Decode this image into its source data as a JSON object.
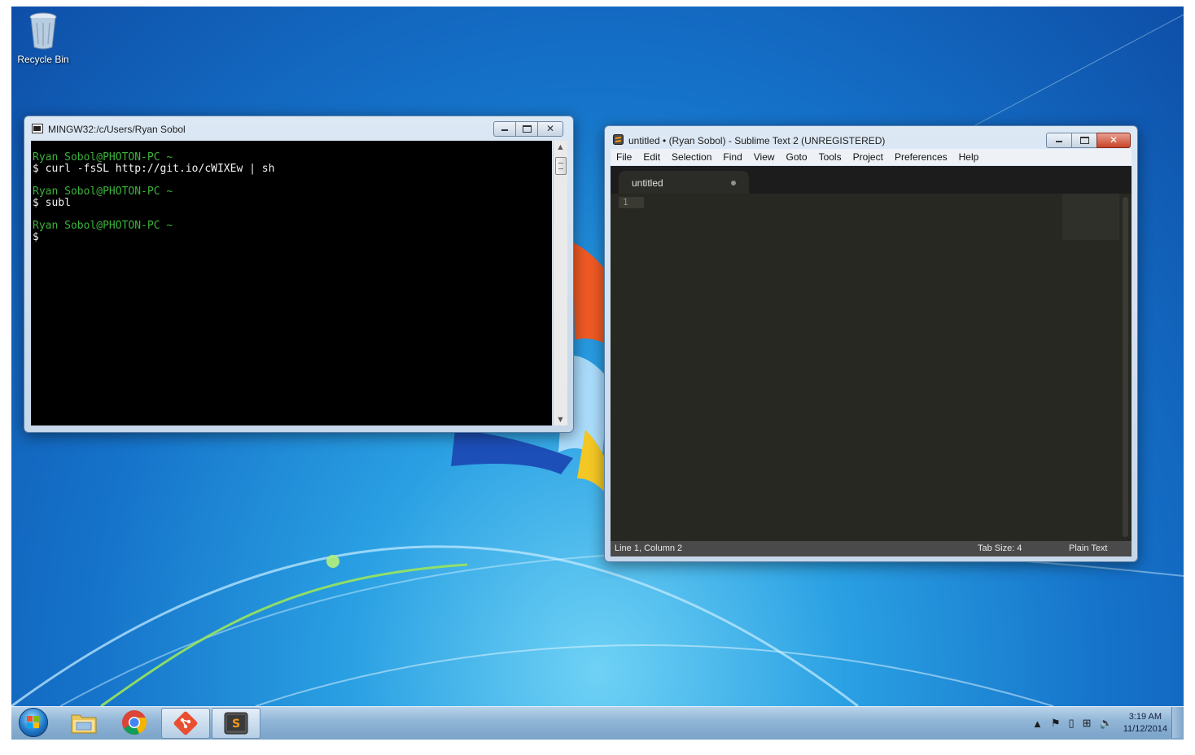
{
  "desktop": {
    "icons": [
      {
        "label": "Recycle Bin",
        "icon": "recycle-bin-icon"
      }
    ]
  },
  "terminal": {
    "title": "MINGW32:/c/Users/Ryan Sobol",
    "lines": [
      {
        "text": "Ryan Sobol@PHOTON-PC ~",
        "color": "#3bb33b"
      },
      {
        "text": "$ curl -fsSL http://git.io/cWIXEw | sh",
        "color": "#f2f2f2"
      },
      {
        "text": "Ryan Sobol@PHOTON-PC ~",
        "color": "#3bb33b"
      },
      {
        "text": "$ subl",
        "color": "#f2f2f2"
      },
      {
        "text": "Ryan Sobol@PHOTON-PC ~",
        "color": "#3bb33b"
      },
      {
        "text": "$",
        "color": "#f2f2f2"
      }
    ]
  },
  "sublime": {
    "title": "untitled • (Ryan Sobol) - Sublime Text 2 (UNREGISTERED)",
    "menu": [
      "File",
      "Edit",
      "Selection",
      "Find",
      "View",
      "Goto",
      "Tools",
      "Project",
      "Preferences",
      "Help"
    ],
    "tab_label": "untitled",
    "line_number": "1",
    "status": {
      "position": "Line 1, Column 2",
      "tab_size": "Tab Size: 4",
      "syntax": "Plain Text"
    }
  },
  "taskbar": {
    "apps": [
      "start-orb",
      "windows-explorer",
      "google-chrome",
      "git-bash",
      "sublime-text"
    ],
    "clock": {
      "time": "3:19 AM",
      "date": "11/12/2014"
    }
  },
  "colors": {
    "terminal_prompt": "#3bb33b",
    "sublime_bg": "#272822",
    "desktop_blue": "#1572c9"
  }
}
